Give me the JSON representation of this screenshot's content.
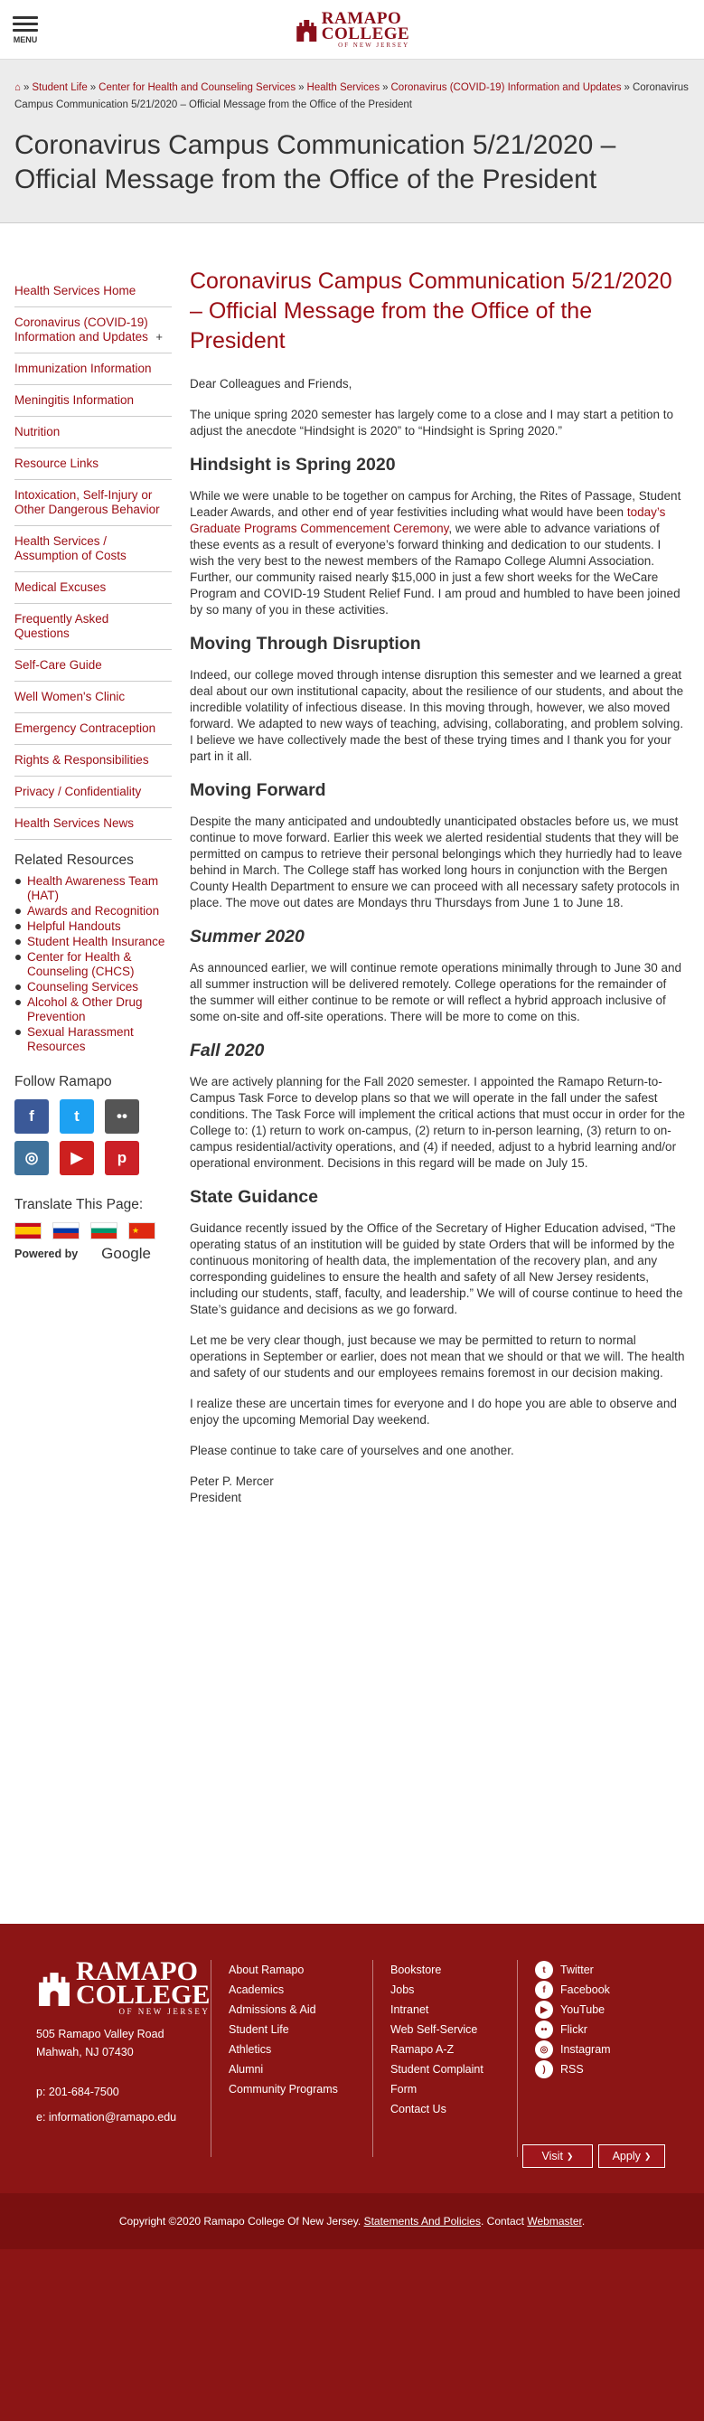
{
  "header": {
    "menu_label": "MENU",
    "logo_main": "RAMAPO",
    "logo_main2": "COLLEGE",
    "logo_sub": "OF NEW JERSEY"
  },
  "breadcrumb": {
    "home_icon": "home-icon",
    "items": [
      "Student Life",
      "Center for Health and Counseling Services",
      "Health Services",
      "Coronavirus (COVID-19) Information and Updates"
    ],
    "current": "Coronavirus Campus Communication 5/21/2020 – Official Message from the Office of the President"
  },
  "page_title": "Coronavirus Campus Communication 5/21/2020 – Official Message from the Office of the President",
  "sidebar": {
    "nav": [
      "Health Services Home",
      "Coronavirus (COVID-19) Information and Updates",
      "Immunization Information",
      "Meningitis Information",
      "Nutrition",
      "Resource Links",
      "Intoxication, Self-Injury or Other Dangerous Behavior",
      "Health Services / Assumption of Costs",
      "Medical Excuses",
      "Frequently Asked Questions",
      "Self-Care Guide",
      "Well Women's Clinic",
      "Emergency Contraception",
      "Rights & Responsibilities",
      "Privacy / Confidentiality",
      "Health Services News"
    ],
    "expand_symbol": "+",
    "related_heading": "Related Resources",
    "related": [
      "Health Awareness Team (HAT)",
      "Awards and Recognition",
      "Helpful Handouts",
      "Student Health Insurance",
      "Center for Health & Counseling (CHCS)",
      "Counseling Services",
      "Alcohol & Other Drug Prevention",
      "Sexual Harassment Resources"
    ],
    "follow_heading": "Follow Ramapo",
    "social_icons": [
      {
        "name": "facebook-icon",
        "glyph": "f",
        "color": "#3b5998"
      },
      {
        "name": "twitter-icon",
        "glyph": "t",
        "color": "#1da1f2"
      },
      {
        "name": "flickr-icon",
        "glyph": "••",
        "color": "#555555"
      },
      {
        "name": "instagram-icon",
        "glyph": "◎",
        "color": "#3f729b"
      },
      {
        "name": "youtube-icon",
        "glyph": "▶",
        "color": "#cd201f"
      },
      {
        "name": "pinterest-icon",
        "glyph": "p",
        "color": "#cb2027"
      }
    ],
    "translate_heading": "Translate This Page:",
    "powered_by": "Powered by",
    "google": "Google"
  },
  "article": {
    "heading": "Coronavirus Campus Communication 5/21/2020 – Official Message from the Office of the President",
    "greeting": "Dear Colleagues and Friends,",
    "intro": "The unique spring 2020 semester has largely come to a close and I may start a petition to adjust the anecdote “Hindsight is 2020” to “Hindsight is Spring 2020.”",
    "h_hindsight": "Hindsight is Spring 2020",
    "p_hindsight_a": "While we were unable to be together on campus for Arching, the Rites of Passage, Student Leader Awards, and other end of year festivities including what would have been ",
    "p_hindsight_link": "today’s Graduate Programs Commencement Ceremony",
    "p_hindsight_b": ", we were able to advance variations of these events as a result of everyone’s forward thinking and dedication to our students. I wish the very best to the newest members of the Ramapo College Alumni Association. Further, our community raised nearly $15,000 in just a few short weeks for the WeCare Program and COVID-19 Student Relief Fund. I am proud and humbled to have been joined by so many of you in these activities.",
    "h_disruption": "Moving Through Disruption",
    "p_disruption": "Indeed, our college moved through intense disruption this semester and we learned a great deal about our own institutional capacity, about the resilience of our students, and about the incredible volatility of infectious disease. In this moving through, however, we also moved forward. We adapted to new ways of teaching, advising, collaborating, and problem solving. I believe we have collectively made the best of these trying times and I thank you for your part in it all.",
    "h_forward": "Moving Forward",
    "p_forward": "Despite the many anticipated and undoubtedly unanticipated obstacles before us, we must continue to move forward. Earlier this week we alerted residential students that they will be permitted on campus to retrieve their personal belongings which they hurriedly had to leave behind in March. The College staff has worked long hours in conjunction with the Bergen County Health Department to ensure we can proceed with all necessary safety protocols in place. The move out dates are Mondays thru Thursdays from June 1 to June 18.",
    "h_summer": "Summer 2020",
    "p_summer": "As announced earlier, we will continue remote operations minimally through to June 30 and all summer instruction will be delivered remotely. College operations for the remainder of the summer will either continue to be remote or will reflect a hybrid approach inclusive of some on-site and off-site operations. There will be more to come on this.",
    "h_fall": "Fall 2020",
    "p_fall": "We are actively planning for the Fall 2020 semester. I appointed the Ramapo Return-to-Campus Task Force to develop plans so that we will operate in the fall under the safest conditions. The Task Force will implement the critical actions that must occur in order for the College to: (1) return to work on-campus, (2) return to in-person learning, (3) return to on-campus residential/activity operations, and (4) if needed, adjust to a hybrid learning and/or operational environment. Decisions in this regard will be made on July 15.",
    "h_state": "State Guidance",
    "p_state": "Guidance recently issued by the Office of the Secretary of Higher Education advised, “The operating status of an institution will be guided by state Orders that will be informed by the continuous monitoring of health data, the implementation of the recovery plan, and any corresponding guidelines to ensure the health and safety of all New Jersey residents, including our students, staff, faculty, and leadership.” We will of course continue to heed the State’s guidance and decisions as we go forward.",
    "p_clear": "Let me be very clear though, just because we may be permitted to return to normal operations in September or earlier, does not mean that we should or that we will. The health and safety of our students and our employees remains foremost in our decision making.",
    "p_realize": "I realize these are uncertain times for everyone and I do hope you are able to observe and enjoy the upcoming Memorial Day weekend.",
    "p_care": "Please continue to take care of yourselves and one another.",
    "sig_name": "Peter P. Mercer",
    "sig_title": "President"
  },
  "footer": {
    "logo_main": "RAMAPO",
    "logo_main2": "COLLEGE",
    "logo_sub": "OF NEW JERSEY",
    "address1": "505 Ramapo Valley Road",
    "address2": "Mahwah, NJ 07430",
    "phone": "p: 201-684-7500",
    "email": "e: information@ramapo.edu",
    "col1": [
      "About Ramapo",
      "Academics",
      "Admissions & Aid",
      "Student Life",
      "Athletics",
      "Alumni",
      "Community Programs"
    ],
    "col2": [
      "Bookstore",
      "Jobs",
      "Intranet",
      "Web Self-Service",
      "Ramapo A-Z",
      "Student Complaint Form",
      "Contact Us"
    ],
    "social": [
      {
        "label": "Twitter",
        "icon": "twitter-icon",
        "glyph": "t"
      },
      {
        "label": "Facebook",
        "icon": "facebook-icon",
        "glyph": "f"
      },
      {
        "label": "YouTube",
        "icon": "youtube-icon",
        "glyph": "▶"
      },
      {
        "label": "Flickr",
        "icon": "flickr-icon",
        "glyph": "••"
      },
      {
        "label": "Instagram",
        "icon": "instagram-icon",
        "glyph": "◎"
      },
      {
        "label": "RSS",
        "icon": "rss-icon",
        "glyph": ")"
      }
    ],
    "visit_label": "Visit",
    "apply_label": "Apply",
    "arrow": "❯",
    "copyright": "Copyright ©2020 Ramapo College Of New Jersey.",
    "statements": "Statements And Policies",
    "contact": "Contact",
    "webmaster": "Webmaster",
    "accent_color": "#8c1515"
  }
}
